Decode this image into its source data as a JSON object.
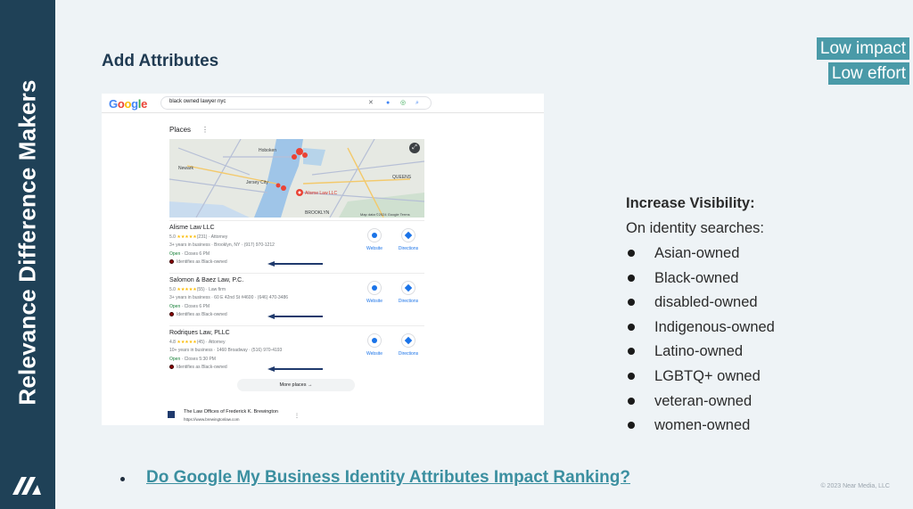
{
  "sidebar": {
    "title": "Relevance Difference Makers"
  },
  "slide": {
    "title": "Add Attributes"
  },
  "badges": {
    "impact": "Low impact",
    "effort": "Low effort"
  },
  "google": {
    "query": "black owned lawyer nyc",
    "places_heading": "Places",
    "map_labels": {
      "newark": "Newark",
      "jersey_city": "Jersey City",
      "queens": "QUEENS",
      "brooklyn": "BROOKLYN",
      "hoboken": "Hoboken",
      "alisme_pin": "Alisme Law LLC",
      "attribution": "Map data ©2024 Google   Terms"
    },
    "listings": [
      {
        "name": "Alisme Law LLC",
        "rating": "5.0",
        "stars": "★★★★★",
        "rating_rest": "(231) · Attorney",
        "details": "3+ years in business · Brooklyn, NY · (917) 970-1212",
        "status_open": "Open",
        "status_rest": " · Closes 6 PM",
        "identity": "Identifies as Black-owned",
        "website": "Website",
        "directions": "Directions"
      },
      {
        "name": "Salomon & Baez Law, P.C.",
        "rating": "5.0",
        "stars": "★★★★★",
        "rating_rest": "(55) · Law firm",
        "details": "3+ years in business · 60 E 42nd St #4600 · (646) 470-3486",
        "status_open": "Open",
        "status_rest": " · Closes 6 PM",
        "identity": "Identifies as Black-owned",
        "website": "Website",
        "directions": "Directions"
      },
      {
        "name": "Rodriques Law, PLLC",
        "rating": "4.8",
        "stars": "★★★★★",
        "rating_rest": "(45) · Attorney",
        "details": "10+ years in business · 1460 Broadway · (516) 970-4193",
        "status_open": "Open",
        "status_rest": " · Closes 5:30 PM",
        "identity": "Identifies as Black-owned",
        "website": "Website",
        "directions": "Directions"
      }
    ],
    "more_places": "More places  →",
    "organic": {
      "name": "The Law Offices of Frederick K. Brewington",
      "url": "https://www.brewingtonlaw.com"
    }
  },
  "visibility": {
    "heading": "Increase Visibility:",
    "subheading": "On identity searches:",
    "items": [
      "Asian-owned",
      "Black-owned",
      "disabled-owned",
      "Indigenous-owned",
      "Latino-owned",
      "LGBTQ+ owned",
      "veteran-owned",
      "women-owned"
    ]
  },
  "link": {
    "text": "Do Google My Business Identity Attributes Impact Ranking?"
  },
  "footer": {
    "copyright": "© 2023 Near Media, LLC"
  },
  "colors": {
    "sidebar": "#1f4157",
    "badge": "#4a9aa8",
    "link": "#3b8fa0",
    "arrow": "#1f3a6d"
  },
  "icons": {
    "logo": "near-media-logo",
    "website": "globe-icon",
    "directions": "directions-icon",
    "search": "search-icon",
    "mic": "mic-icon",
    "lens": "lens-icon",
    "clear": "close-icon",
    "map_toggle": "fullscreen-icon"
  }
}
